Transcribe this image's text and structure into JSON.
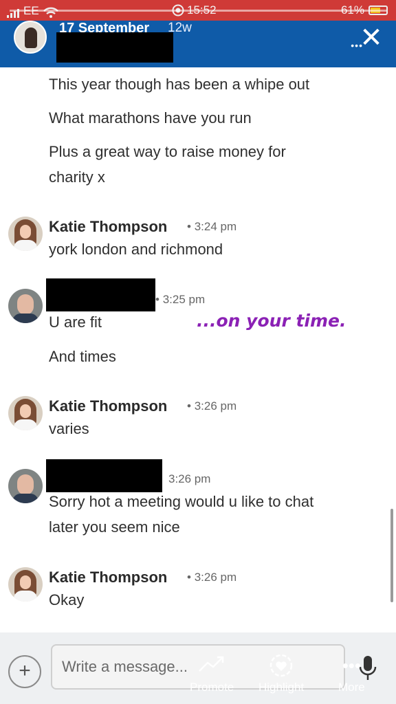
{
  "status_bar": {
    "carrier": "EE",
    "time": "15:52",
    "battery": "61%",
    "battery_color": "#f2c21b",
    "background_color": "#cf3a37"
  },
  "story_header": {
    "date": "17 September",
    "age": "12w",
    "background_color": "#0f5ba8"
  },
  "conversation": {
    "intro_lines": [
      "This year though has been a whipe out",
      "What marathons have you run",
      "Plus a great way to raise money for",
      "charity x"
    ],
    "messages": [
      {
        "sender": "Katie Thompson",
        "time": "3:24 pm",
        "lines": [
          "york london and richmond"
        ]
      },
      {
        "sender": "",
        "time": "3:25 pm",
        "lines": [
          "U are fit",
          "And times"
        ]
      },
      {
        "sender": "Katie Thompson",
        "time": "3:26 pm",
        "lines": [
          "varies"
        ]
      },
      {
        "sender": "",
        "time": "3:26 pm",
        "lines": [
          "Sorry hot a meeting would u like to chat",
          "later you seem nice"
        ]
      },
      {
        "sender": "Katie Thompson",
        "time": "3:26 pm",
        "lines": [
          "Okay"
        ]
      }
    ]
  },
  "sticker": {
    "text": "...on your time.",
    "color": "#8b21b5"
  },
  "composer": {
    "placeholder": "Write a message...",
    "actions": {
      "promote": "Promote",
      "highlight": "Highlight",
      "more": "More"
    }
  },
  "icons": [
    "signal-icon",
    "wifi-icon",
    "battery-icon",
    "close-icon",
    "plus-icon",
    "microphone-icon",
    "promote-icon",
    "highlight-icon",
    "more-icon"
  ]
}
